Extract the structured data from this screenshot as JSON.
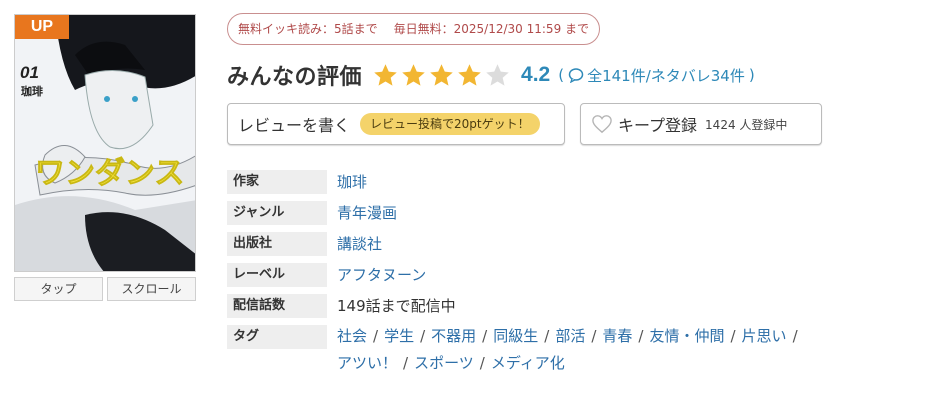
{
  "cover": {
    "badge": "UP",
    "volume": "01",
    "author_mark": "珈琲"
  },
  "view_buttons": [
    {
      "label": "タップ"
    },
    {
      "label": "スクロール"
    }
  ],
  "free_info": {
    "bulk_free": "無料イッキ読み：5話まで",
    "daily_free": "毎日無料：2025/12/30 11:59 まで"
  },
  "rating": {
    "title": "みんなの評価",
    "score": "4.2",
    "stars_filled": 4,
    "stars_total": 5,
    "counts_open": "(",
    "counts_text": "全141件/ネタバレ34件",
    "counts_close": ")"
  },
  "review_button": {
    "label": "レビューを書く",
    "badge": "レビュー投稿で20ptゲット！"
  },
  "keep_button": {
    "label": "キープ登録",
    "count": "1424 人登録中"
  },
  "info": {
    "author_label": "作家",
    "author": "珈琲",
    "genre_label": "ジャンル",
    "genre": "青年漫画",
    "publisher_label": "出版社",
    "publisher": "講談社",
    "label_label": "レーベル",
    "label": "アフタヌーン",
    "episodes_label": "配信話数",
    "episodes": "149話まで配信中",
    "tags_label": "タグ",
    "tags": [
      "社会",
      "学生",
      "不器用",
      "同級生",
      "部活",
      "青春",
      "友情・仲間",
      "片思い",
      "アツい！",
      "スポーツ",
      "メディア化"
    ],
    "tag_separator": "/"
  },
  "colors": {
    "accent_blue": "#2e89b8",
    "link_blue": "#2e6fa8",
    "star_gold": "#f2b632",
    "badge_orange": "#e8761e",
    "pill_red": "#b04a4a",
    "points_yellow": "#f4d36a"
  }
}
